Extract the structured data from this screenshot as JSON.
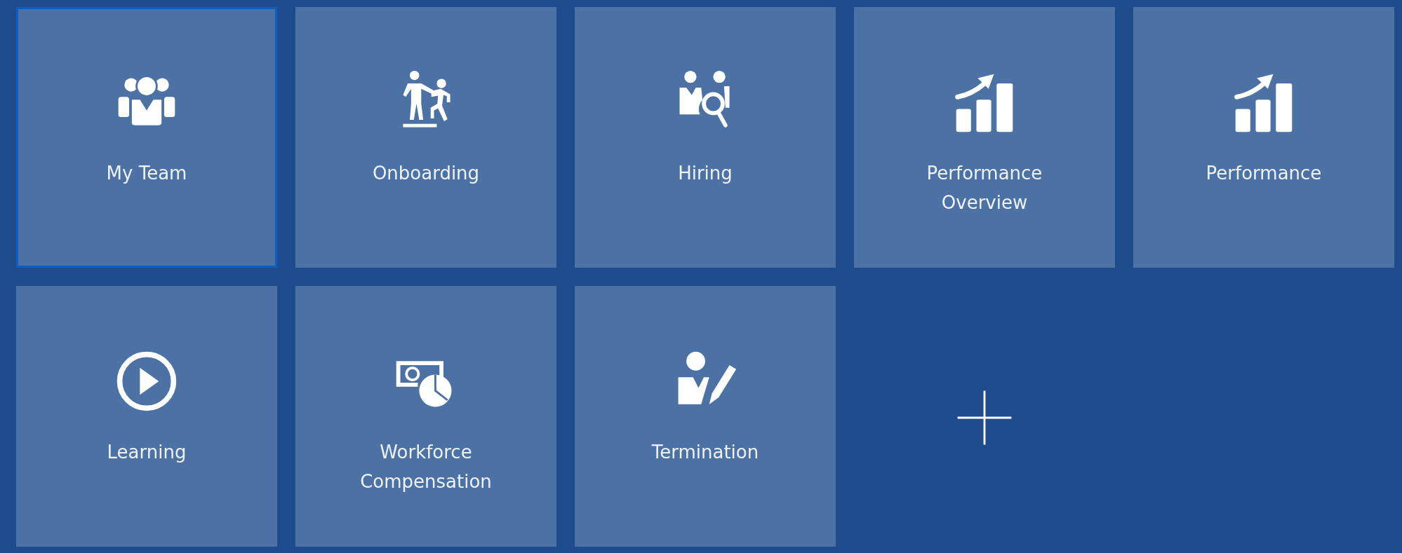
{
  "tiles": [
    {
      "kind": "app",
      "label": "My Team",
      "selected": true
    },
    {
      "kind": "app",
      "label": "Onboarding",
      "selected": false
    },
    {
      "kind": "app",
      "label": "Hiring",
      "selected": false
    },
    {
      "kind": "app",
      "label": "Performance Overview",
      "selected": false
    },
    {
      "kind": "app",
      "label": "Performance",
      "selected": false
    },
    {
      "kind": "app",
      "label": "Learning",
      "selected": false
    },
    {
      "kind": "app",
      "label": "Workforce Compensation",
      "selected": false
    },
    {
      "kind": "app",
      "label": "Termination",
      "selected": false
    },
    {
      "kind": "add",
      "selected": false
    }
  ]
}
